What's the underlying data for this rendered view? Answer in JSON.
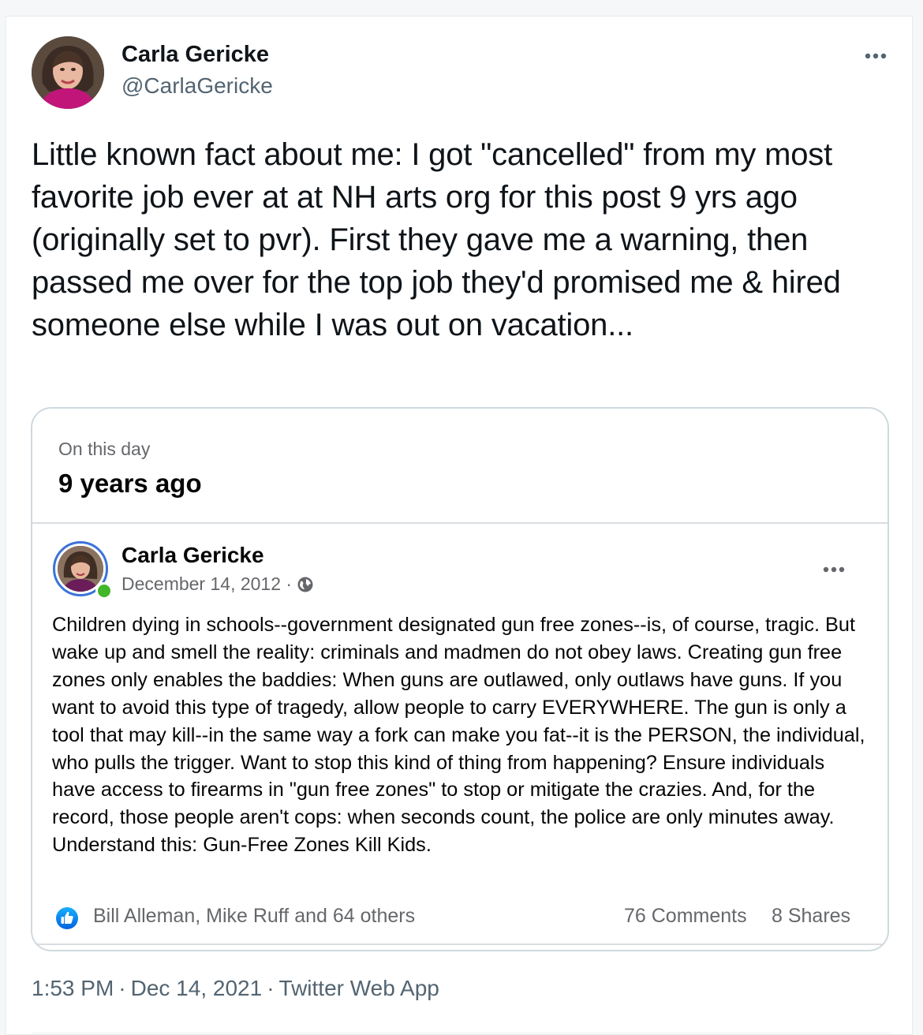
{
  "tweet": {
    "author_name": "Carla Gericke",
    "author_handle": "@CarlaGericke",
    "text": "Little known fact about me: I got \"cancelled\" from my most favorite job ever at at NH arts org for this post 9 yrs ago (originally set to pvr). First they gave me a warning, then passed me over for the top job they'd promised me & hired someone else while I was out on vacation...",
    "time": "1:53 PM",
    "date": "Dec 14, 2021",
    "source": "Twitter Web App",
    "separator": "·",
    "more_icon": "more-horizontal-icon"
  },
  "quoted_post": {
    "header_label": "On this day",
    "header_ago": "9 years ago",
    "author_name": "Carla Gericke",
    "date": "December 14, 2012 ·",
    "privacy_icon": "globe-icon",
    "more_icon": "more-horizontal-icon",
    "text": "Children dying in schools--government designated gun free zones--is, of course, tragic. But wake up and smell the reality: criminals and madmen do not obey laws. Creating gun free zones only enables the baddies: When guns are outlawed, only outlaws have guns. If you want to avoid this type of tragedy, allow people to carry EVERYWHERE. The gun is only a tool that may kill--in the same way a fork can make you fat--it is the PERSON, the individual, who pulls the trigger. Want to stop this kind of thing from happening? Ensure individuals have access to firearms in \"gun free zones\" to stop or mitigate the crazies. And, for the record, those people aren't cops: when seconds count, the police are only minutes away. Understand this: Gun-Free Zones Kill Kids.",
    "reactions_icon": "like-icon",
    "reactors": "Bill Alleman, Mike Ruff and 64 others",
    "comments": "76 Comments",
    "shares": "8 Shares"
  },
  "colors": {
    "fb_blue": "#1877f2",
    "online_green": "#42b72a",
    "twitter_secondary": "#536471"
  }
}
